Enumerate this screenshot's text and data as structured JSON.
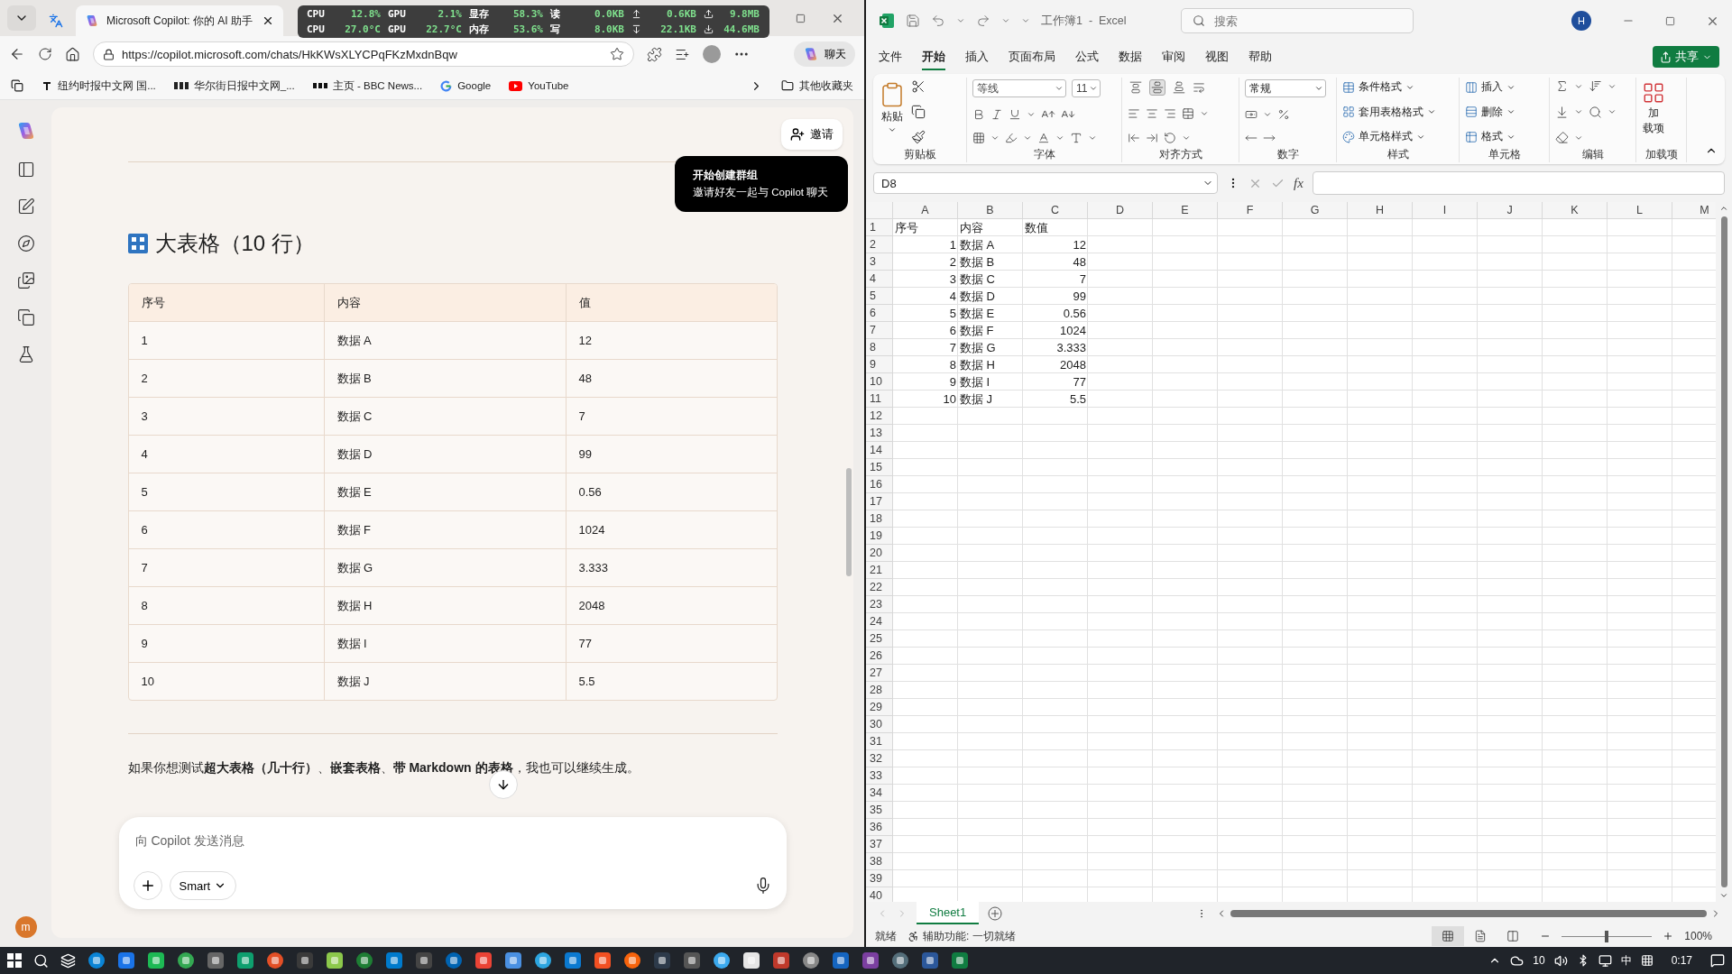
{
  "browser": {
    "tabs": [
      {
        "kind": "translate",
        "selected": false
      },
      {
        "kind": "copilot",
        "title": "Microsoft Copilot: 你的 AI 助手",
        "selected": true
      }
    ],
    "system_monitor": {
      "rows": [
        [
          {
            "kind": "label",
            "label": "CPU",
            "value": "12.8%"
          },
          {
            "kind": "label",
            "label": "GPU",
            "value": "2.1%"
          },
          {
            "kind": "label",
            "label": "显存",
            "value": "58.3%"
          },
          {
            "kind": "label",
            "label": "读",
            "value": "0.0KB"
          },
          {
            "kind": "upload",
            "value": "0.6KB"
          },
          {
            "kind": "upload-total",
            "value": "9.8MB"
          }
        ],
        [
          {
            "kind": "label",
            "label": "CPU",
            "value": "27.0°C"
          },
          {
            "kind": "label",
            "label": "GPU",
            "value": "22.7°C"
          },
          {
            "kind": "label",
            "label": "内存",
            "value": "53.6%"
          },
          {
            "kind": "label",
            "label": "写",
            "value": "8.0KB"
          },
          {
            "kind": "download",
            "value": "22.1KB"
          },
          {
            "kind": "download-total",
            "value": "44.6MB"
          }
        ]
      ]
    },
    "url": "https://copilot.microsoft.com/chats/HkKWsXLYCPqFKzMxdnBqw",
    "copilot_button": "聊天",
    "bookmarks": [
      {
        "kind": "nyt",
        "title": "纽约时报中文网 国..."
      },
      {
        "kind": "wsj",
        "title": "华尔街日报中文网_..."
      },
      {
        "kind": "bbc",
        "title": "主页 - BBC News..."
      },
      {
        "kind": "google",
        "title": "Google"
      },
      {
        "kind": "youtube",
        "title": "YouTube"
      }
    ],
    "other_bookmarks": "其他收藏夹"
  },
  "copilot": {
    "invite_button": "邀请",
    "tooltip": {
      "title": "开始创建群组",
      "body": "邀请好友一起与 Copilot 聊天"
    },
    "heading": "大表格（10 行）",
    "table": {
      "columns": [
        "序号",
        "内容",
        "值"
      ],
      "rows": [
        [
          "1",
          "数据 A",
          "12"
        ],
        [
          "2",
          "数据 B",
          "48"
        ],
        [
          "3",
          "数据 C",
          "7"
        ],
        [
          "4",
          "数据 D",
          "99"
        ],
        [
          "5",
          "数据 E",
          "0.56"
        ],
        [
          "6",
          "数据 F",
          "1024"
        ],
        [
          "7",
          "数据 G",
          "3.333"
        ],
        [
          "8",
          "数据 H",
          "2048"
        ],
        [
          "9",
          "数据 I",
          "77"
        ],
        [
          "10",
          "数据 J",
          "5.5"
        ]
      ]
    },
    "paragraph": "如果你想测试**超大表格（几十行）**、**嵌套表格**、**带 Markdown 的表格**，我也可以继续生成。",
    "composer": {
      "placeholder": "向 Copilot 发送消息",
      "mode": "Smart"
    },
    "avatar": "m"
  },
  "excel": {
    "title": "工作簿1  -  Excel",
    "search_placeholder": "搜索",
    "avatar": "H",
    "menu": [
      {
        "label": "文件",
        "selected": false
      },
      {
        "label": "开始",
        "selected": true
      },
      {
        "label": "插入",
        "selected": false
      },
      {
        "label": "页面布局",
        "selected": false
      },
      {
        "label": "公式",
        "selected": false
      },
      {
        "label": "数据",
        "selected": false
      },
      {
        "label": "审阅",
        "selected": false
      },
      {
        "label": "视图",
        "selected": false
      },
      {
        "label": "帮助",
        "selected": false
      }
    ],
    "share": "共享",
    "ribbon": {
      "groups": [
        {
          "kind": "clipboard",
          "label": "剪贴板",
          "buttons": [
            "粘贴"
          ]
        },
        {
          "kind": "font",
          "label": "字体",
          "font": "等线",
          "size": "11"
        },
        {
          "kind": "align",
          "label": "对齐方式",
          "vertical_align": [
            {
              "selected": false
            },
            {
              "selected": true
            },
            {
              "selected": false
            }
          ]
        },
        {
          "kind": "number",
          "label": "数字",
          "format": "常规"
        },
        {
          "kind": "styles",
          "label": "样式",
          "buttons": [
            "条件格式",
            "套用表格格式",
            "单元格样式"
          ]
        },
        {
          "kind": "cells",
          "label": "单元格",
          "buttons": [
            "插入",
            "删除",
            "格式"
          ]
        },
        {
          "kind": "editing",
          "label": "编辑"
        },
        {
          "kind": "addins",
          "label": "加载项",
          "buttons": [
            "加",
            "载项"
          ]
        }
      ]
    },
    "name_box": "D8",
    "function_label": "fx",
    "columns": [
      "A",
      "B",
      "C",
      "D",
      "E",
      "F",
      "G",
      "H",
      "I",
      "J",
      "K",
      "L",
      "M"
    ],
    "row_numbers": [
      "1",
      "2",
      "3",
      "4",
      "5",
      "6",
      "7",
      "8",
      "9",
      "10",
      "11",
      "12",
      "13",
      "14",
      "15",
      "16",
      "17",
      "18",
      "19",
      "20",
      "21",
      "22",
      "23",
      "24",
      "25",
      "26",
      "27",
      "28",
      "29",
      "30",
      "31",
      "32",
      "33",
      "34",
      "35",
      "36",
      "37",
      "38",
      "39",
      "40"
    ],
    "cells": [
      [
        {
          "text": "序号",
          "numeric": false
        },
        {
          "text": "内容",
          "numeric": false
        },
        {
          "text": "数值",
          "numeric": false
        }
      ],
      [
        {
          "text": "1",
          "numeric": true
        },
        {
          "text": "数据 A",
          "numeric": false
        },
        {
          "text": "12",
          "numeric": true
        }
      ],
      [
        {
          "text": "2",
          "numeric": true
        },
        {
          "text": "数据 B",
          "numeric": false
        },
        {
          "text": "48",
          "numeric": true
        }
      ],
      [
        {
          "text": "3",
          "numeric": true
        },
        {
          "text": "数据 C",
          "numeric": false
        },
        {
          "text": "7",
          "numeric": true
        }
      ],
      [
        {
          "text": "4",
          "numeric": true
        },
        {
          "text": "数据 D",
          "numeric": false
        },
        {
          "text": "99",
          "numeric": true
        }
      ],
      [
        {
          "text": "5",
          "numeric": true
        },
        {
          "text": "数据 E",
          "numeric": false
        },
        {
          "text": "0.56",
          "numeric": true
        }
      ],
      [
        {
          "text": "6",
          "numeric": true
        },
        {
          "text": "数据 F",
          "numeric": false
        },
        {
          "text": "1024",
          "numeric": true
        }
      ],
      [
        {
          "text": "7",
          "numeric": true
        },
        {
          "text": "数据 G",
          "numeric": false
        },
        {
          "text": "3.333",
          "numeric": true
        }
      ],
      [
        {
          "text": "8",
          "numeric": true
        },
        {
          "text": "数据 H",
          "numeric": false
        },
        {
          "text": "2048",
          "numeric": true
        }
      ],
      [
        {
          "text": "9",
          "numeric": true
        },
        {
          "text": "数据 I",
          "numeric": false
        },
        {
          "text": "77",
          "numeric": true
        }
      ],
      [
        {
          "text": "10",
          "numeric": true
        },
        {
          "text": "数据 J",
          "numeric": false
        },
        {
          "text": "5.5",
          "numeric": true
        }
      ]
    ],
    "sheets": [
      {
        "label": "Sheet1",
        "selected": true
      }
    ],
    "status": "就绪",
    "accessibility": "辅助功能: 一切就绪",
    "views": [
      {
        "selected": true
      },
      {
        "selected": false
      },
      {
        "selected": false
      }
    ],
    "zoom": {
      "level": 0.5,
      "label": "100%"
    }
  },
  "taskbar": {
    "tray_count": "10",
    "ime": "中",
    "clock": "0:17"
  }
}
